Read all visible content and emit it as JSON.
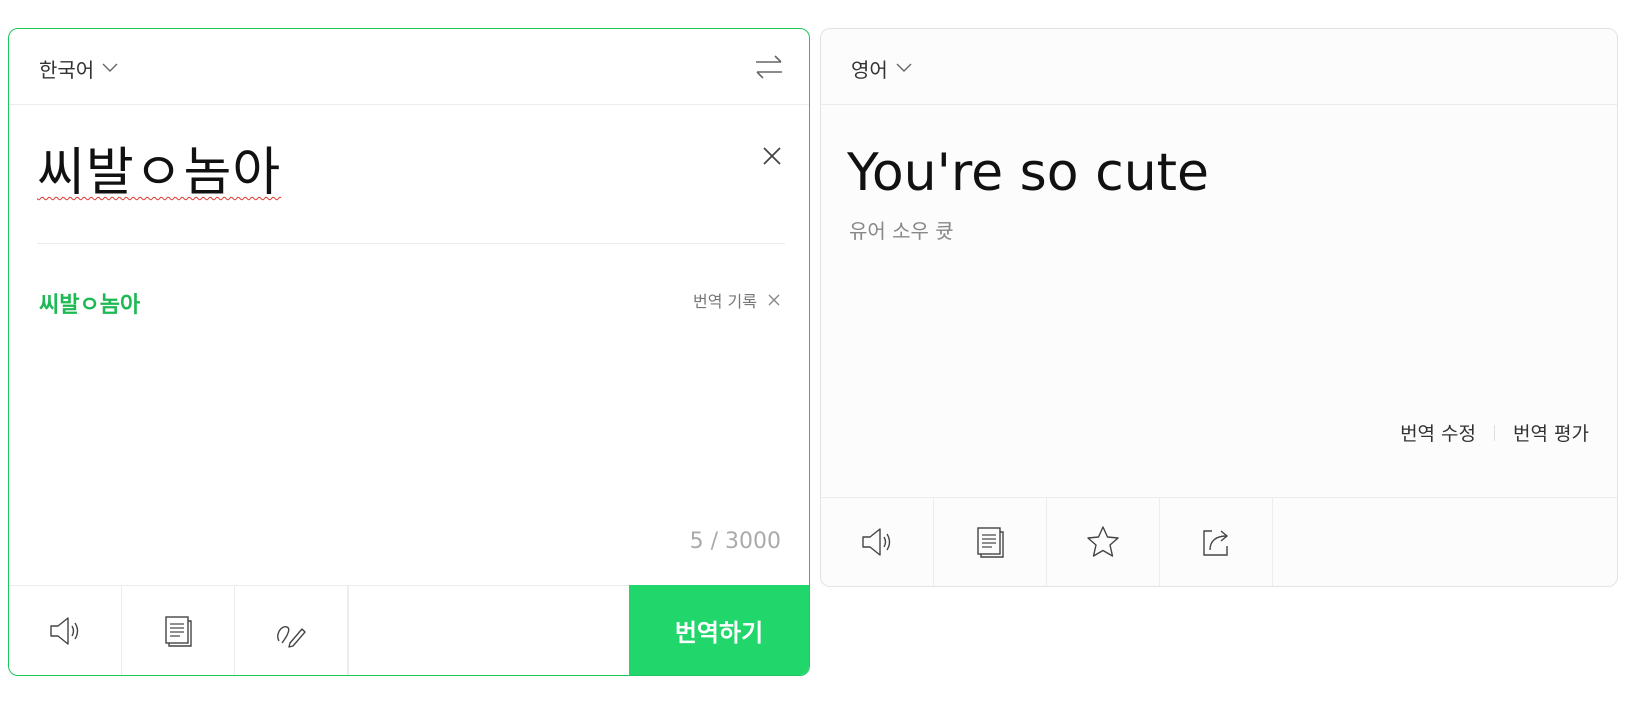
{
  "source": {
    "language": "한국어",
    "text": "씨발ㅇ놈아",
    "suggestion": "씨발ㅇ놈아",
    "history_label": "번역 기록",
    "char_count": "5 / 3000",
    "translate_label": "번역하기",
    "icons": [
      "speaker-icon",
      "dictionary-icon",
      "handwriting-icon",
      "swap-icon",
      "close-icon"
    ]
  },
  "target": {
    "language": "영어",
    "text": "You're so cute",
    "pronunciation": "유어 소우 큣",
    "edit_label": "번역 수정",
    "rate_label": "번역 평가",
    "icons": [
      "speaker-icon",
      "dictionary-icon",
      "star-icon",
      "share-icon"
    ]
  },
  "colors": {
    "accent": "#21d66a",
    "source_border": "#1ec85f",
    "suggestion_text": "#1db954",
    "spell_underline": "#e0352f"
  }
}
